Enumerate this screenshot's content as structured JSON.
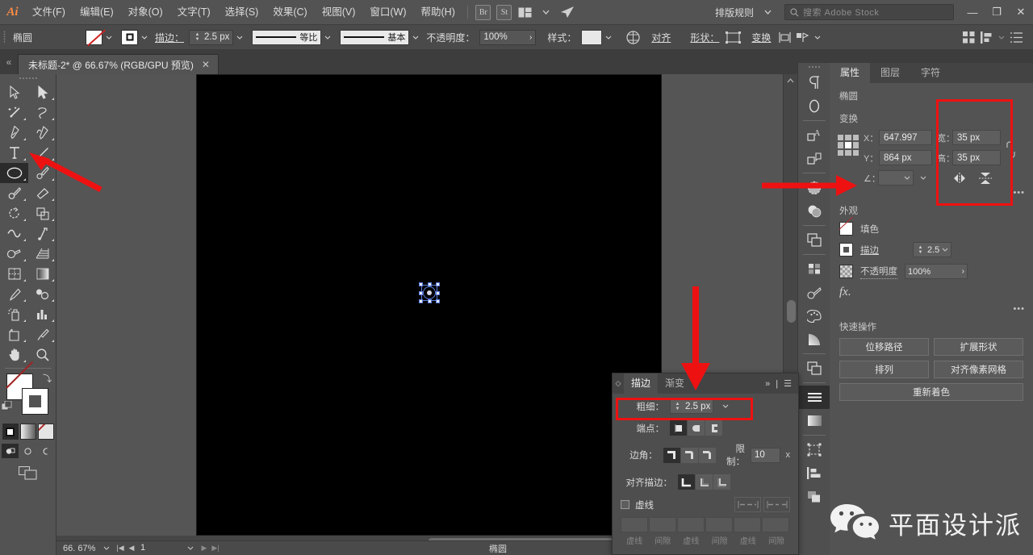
{
  "app": {
    "name": "Ai",
    "title": "Adobe Illustrator"
  },
  "menubar": {
    "items": [
      {
        "label": "文件(F)"
      },
      {
        "label": "编辑(E)"
      },
      {
        "label": "对象(O)"
      },
      {
        "label": "文字(T)"
      },
      {
        "label": "选择(S)"
      },
      {
        "label": "效果(C)"
      },
      {
        "label": "视图(V)"
      },
      {
        "label": "窗口(W)"
      },
      {
        "label": "帮助(H)"
      }
    ],
    "bridge_badge": "Br",
    "stock_badge": "St",
    "workspace": "排版规则",
    "search_placeholder": "搜索 Adobe Stock",
    "window_minimize": "—",
    "window_restore": "❐",
    "window_close": "✕"
  },
  "controlbar": {
    "object_type": "椭圆",
    "fill_label": "填色",
    "stroke_label": "描边：",
    "stroke_weight": "2.5 px",
    "profile_label": "等比",
    "brush_label": "基本",
    "opacity_label": "不透明度：",
    "opacity_value": "100%",
    "style_label": "样式：",
    "align_label": "对齐",
    "shape_label": "形状：",
    "transform_label": "变换"
  },
  "tabbar": {
    "document_tab": "未标题-2* @ 66.67% (RGB/GPU 预览)",
    "close_glyph": "✕"
  },
  "toolbar": {
    "tools": [
      {
        "name": "selection-tool"
      },
      {
        "name": "direct-selection-tool"
      },
      {
        "name": "magic-wand-tool"
      },
      {
        "name": "lasso-tool"
      },
      {
        "name": "pen-tool"
      },
      {
        "name": "curvature-tool"
      },
      {
        "name": "type-tool"
      },
      {
        "name": "line-segment-tool"
      },
      {
        "name": "ellipse-tool"
      },
      {
        "name": "paintbrush-tool"
      },
      {
        "name": "shaper-tool"
      },
      {
        "name": "eraser-tool"
      },
      {
        "name": "rotate-tool"
      },
      {
        "name": "scale-tool"
      },
      {
        "name": "width-tool"
      },
      {
        "name": "free-transform-tool"
      },
      {
        "name": "shape-builder-tool"
      },
      {
        "name": "perspective-grid-tool"
      },
      {
        "name": "mesh-tool"
      },
      {
        "name": "gradient-tool"
      },
      {
        "name": "eyedropper-tool"
      },
      {
        "name": "blend-tool"
      },
      {
        "name": "symbol-sprayer-tool"
      },
      {
        "name": "column-graph-tool"
      },
      {
        "name": "artboard-tool"
      },
      {
        "name": "slice-tool"
      },
      {
        "name": "hand-tool"
      },
      {
        "name": "zoom-tool"
      }
    ],
    "selected_tool": "ellipse-tool"
  },
  "canvas": {
    "artboard_color": "#000000",
    "selected_object": "ellipse"
  },
  "statusbar": {
    "zoom": "66. 67%",
    "page": "1",
    "tool_name": "椭圆"
  },
  "properties": {
    "tabs": [
      {
        "label": "属性",
        "active": true
      },
      {
        "label": "图层",
        "active": false
      },
      {
        "label": "字符",
        "active": false
      }
    ],
    "object_name": "椭圆",
    "transform": {
      "title": "变换",
      "x_label": "X：",
      "x_value": "647.997",
      "y_label": "Y：",
      "y_value": "864 px",
      "w_label": "宽：",
      "w_value": "35 px",
      "h_label": "高：",
      "h_value": "35 px",
      "angle_label": "∠："
    },
    "appearance": {
      "title": "外观",
      "fill_label": "填色",
      "stroke_label": "描边",
      "stroke_value": "2.5 ",
      "opacity_label": "不透明度",
      "opacity_value": "100%",
      "fx_label": "fx."
    },
    "quick_actions": {
      "title": "快速操作",
      "buttons": [
        {
          "label": "位移路径"
        },
        {
          "label": "扩展形状"
        },
        {
          "label": "排列"
        },
        {
          "label": "对齐像素网格"
        },
        {
          "label": "重新着色"
        }
      ]
    }
  },
  "stroke_panel": {
    "tabs": [
      {
        "label": "描边",
        "active": true
      },
      {
        "label": "渐变",
        "active": false
      }
    ],
    "expand_glyph": "»",
    "menu_glyph": "☰",
    "weight_label": "粗细：",
    "weight_value": "2.5 px",
    "cap_label": "端点：",
    "corner_label": "边角：",
    "limit_label": "限制：",
    "limit_value": "10",
    "limit_unit": "x",
    "align_label": "对齐描边：",
    "dashed_label": "虚线",
    "dash_field_labels": [
      "虚线",
      "间隙",
      "虚线",
      "间隙",
      "虚线",
      "间隙"
    ]
  },
  "watermark": {
    "text": "平面设计派",
    "icon": "wechat-icon"
  },
  "annotations": {
    "accent_color": "#ee1111",
    "highlights": [
      {
        "name": "transform-wh-highlight"
      },
      {
        "name": "stroke-weight-highlight"
      }
    ],
    "arrows": [
      {
        "name": "arrow-to-ellipse-tool"
      },
      {
        "name": "arrow-to-transform-wh"
      },
      {
        "name": "arrow-to-stroke-weight"
      }
    ]
  }
}
